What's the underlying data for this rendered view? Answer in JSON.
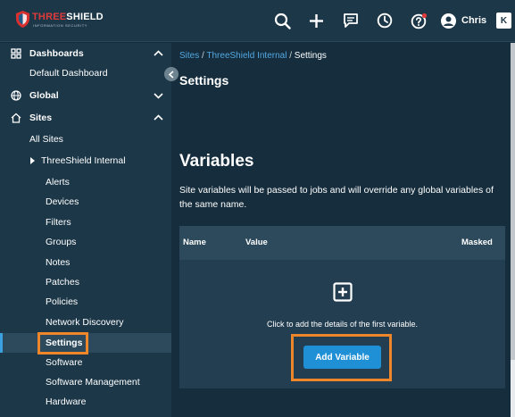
{
  "header": {
    "logo_brand_a": "THREE",
    "logo_brand_b": "SHIELD",
    "logo_tagline": "INFORMATION SECURITY",
    "user_name": "Chris",
    "k_label": "K"
  },
  "sidebar": {
    "items": [
      {
        "label": "Dashboards"
      },
      {
        "label": "Default Dashboard"
      },
      {
        "label": "Global"
      },
      {
        "label": "Sites"
      },
      {
        "label": "All Sites"
      },
      {
        "label": "ThreeShield Internal"
      },
      {
        "label": "Alerts"
      },
      {
        "label": "Devices"
      },
      {
        "label": "Filters"
      },
      {
        "label": "Groups"
      },
      {
        "label": "Notes"
      },
      {
        "label": "Patches"
      },
      {
        "label": "Policies"
      },
      {
        "label": "Network Discovery"
      },
      {
        "label": "Settings"
      },
      {
        "label": "Software"
      },
      {
        "label": "Software Management"
      },
      {
        "label": "Hardware"
      }
    ]
  },
  "breadcrumb": {
    "sites": "Sites",
    "sep1": " / ",
    "site": "ThreeShield Internal",
    "sep2": " / ",
    "current": "Settings"
  },
  "main": {
    "page_title": "Settings",
    "section_title": "Variables",
    "description": "Site variables will be passed to jobs and will override any global variables of the same name.",
    "table": {
      "columns": [
        "Name",
        "Value",
        "Masked"
      ],
      "empty_text": "Click to add the details of the first variable.",
      "add_button": "Add Variable"
    }
  },
  "colors": {
    "accent": "#1f8fd6",
    "link": "#53a8e2",
    "highlight": "#f0862a",
    "sidebar_bg": "#1c3748",
    "page_bg": "#152d3d"
  }
}
